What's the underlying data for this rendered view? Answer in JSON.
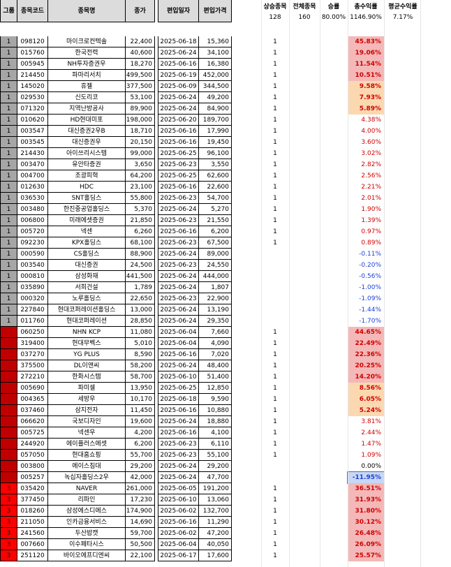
{
  "headers": {
    "group": "그룹",
    "code": "종목코드",
    "name": "종목명",
    "close": "종가",
    "date": "편입일자",
    "price": "편입가격"
  },
  "summary": {
    "labels": [
      "상승종목",
      "전체종목",
      "승률",
      "총수익률",
      "평균수익률"
    ],
    "values": [
      "128",
      "160",
      "80.00%",
      "1146.90%",
      "7.17%"
    ]
  },
  "colors": {
    "group1": "#a6a6a6",
    "group2": "#c00000",
    "group3": "#ff0000",
    "positive_text": "#d00000",
    "negative_text": "#1f3fd6",
    "heat_strong": "#f4b8b8",
    "heat_mid": "#fbd8b0",
    "heat_weak": "#fde9c4",
    "selected_neg": "#c7d7f5"
  },
  "rows": [
    {
      "g": "1",
      "code": "098120",
      "name": "마이크로컨텍솔",
      "close": "22,400",
      "date": "2025-06-18",
      "price": "15,360",
      "up": "1",
      "ret": "45.83%",
      "heat": "strong"
    },
    {
      "g": "1",
      "code": "015760",
      "name": "한국전력",
      "close": "40,600",
      "date": "2025-06-24",
      "price": "34,100",
      "up": "1",
      "ret": "19.06%",
      "heat": "strong"
    },
    {
      "g": "1",
      "code": "005945",
      "name": "NH투자증권우",
      "close": "18,270",
      "date": "2025-06-16",
      "price": "16,380",
      "up": "1",
      "ret": "11.54%",
      "heat": "strong"
    },
    {
      "g": "1",
      "code": "214450",
      "name": "파마리서치",
      "close": "499,500",
      "date": "2025-06-19",
      "price": "452,000",
      "up": "1",
      "ret": "10.51%",
      "heat": "strong"
    },
    {
      "g": "1",
      "code": "145020",
      "name": "휴젤",
      "close": "377,500",
      "date": "2025-06-09",
      "price": "344,500",
      "up": "1",
      "ret": "9.58%",
      "heat": "mid"
    },
    {
      "g": "1",
      "code": "029530",
      "name": "신도리코",
      "close": "53,100",
      "date": "2025-06-24",
      "price": "49,200",
      "up": "1",
      "ret": "7.93%",
      "heat": "mid"
    },
    {
      "g": "1",
      "code": "071320",
      "name": "지역난방공사",
      "close": "89,900",
      "date": "2025-06-24",
      "price": "84,900",
      "up": "1",
      "ret": "5.89%",
      "heat": "mid"
    },
    {
      "g": "1",
      "code": "010620",
      "name": "HD현대미포",
      "close": "198,000",
      "date": "2025-06-20",
      "price": "189,700",
      "up": "1",
      "ret": "4.38%",
      "heat": ""
    },
    {
      "g": "1",
      "code": "003547",
      "name": "대신증권2우B",
      "close": "18,710",
      "date": "2025-06-16",
      "price": "17,990",
      "up": "1",
      "ret": "4.00%",
      "heat": ""
    },
    {
      "g": "1",
      "code": "003545",
      "name": "대신증권우",
      "close": "20,150",
      "date": "2025-06-16",
      "price": "19,450",
      "up": "1",
      "ret": "3.60%",
      "heat": ""
    },
    {
      "g": "1",
      "code": "214430",
      "name": "아이쓰리시스템",
      "close": "99,000",
      "date": "2025-06-25",
      "price": "96,100",
      "up": "1",
      "ret": "3.02%",
      "heat": ""
    },
    {
      "g": "1",
      "code": "003470",
      "name": "유안타증권",
      "close": "3,650",
      "date": "2025-06-23",
      "price": "3,550",
      "up": "1",
      "ret": "2.82%",
      "heat": ""
    },
    {
      "g": "1",
      "code": "004700",
      "name": "조광피혁",
      "close": "64,200",
      "date": "2025-06-25",
      "price": "62,600",
      "up": "1",
      "ret": "2.56%",
      "heat": ""
    },
    {
      "g": "1",
      "code": "012630",
      "name": "HDC",
      "close": "23,100",
      "date": "2025-06-16",
      "price": "22,600",
      "up": "1",
      "ret": "2.21%",
      "heat": ""
    },
    {
      "g": "1",
      "code": "036530",
      "name": "SNT홀딩스",
      "close": "55,800",
      "date": "2025-06-23",
      "price": "54,700",
      "up": "1",
      "ret": "2.01%",
      "heat": ""
    },
    {
      "g": "1",
      "code": "003480",
      "name": "한진중공업홀딩스",
      "close": "5,370",
      "date": "2025-06-24",
      "price": "5,270",
      "up": "1",
      "ret": "1.90%",
      "heat": ""
    },
    {
      "g": "1",
      "code": "006800",
      "name": "미래에셋증권",
      "close": "21,850",
      "date": "2025-06-23",
      "price": "21,550",
      "up": "1",
      "ret": "1.39%",
      "heat": ""
    },
    {
      "g": "1",
      "code": "005720",
      "name": "넥센",
      "close": "6,260",
      "date": "2025-06-16",
      "price": "6,200",
      "up": "1",
      "ret": "0.97%",
      "heat": ""
    },
    {
      "g": "1",
      "code": "092230",
      "name": "KPX홀딩스",
      "close": "68,100",
      "date": "2025-06-23",
      "price": "67,500",
      "up": "1",
      "ret": "0.89%",
      "heat": ""
    },
    {
      "g": "1",
      "code": "000590",
      "name": "CS홀딩스",
      "close": "88,900",
      "date": "2025-06-24",
      "price": "89,000",
      "up": "",
      "ret": "-0.11%",
      "heat": ""
    },
    {
      "g": "1",
      "code": "003540",
      "name": "대신증권",
      "close": "24,500",
      "date": "2025-06-23",
      "price": "24,550",
      "up": "",
      "ret": "-0.20%",
      "heat": ""
    },
    {
      "g": "1",
      "code": "000810",
      "name": "삼성화재",
      "close": "441,500",
      "date": "2025-06-24",
      "price": "444,000",
      "up": "",
      "ret": "-0.56%",
      "heat": ""
    },
    {
      "g": "1",
      "code": "035890",
      "name": "서희건설",
      "close": "1,789",
      "date": "2025-06-24",
      "price": "1,807",
      "up": "",
      "ret": "-1.00%",
      "heat": ""
    },
    {
      "g": "1",
      "code": "000320",
      "name": "노루홀딩스",
      "close": "22,650",
      "date": "2025-06-23",
      "price": "22,900",
      "up": "",
      "ret": "-1.09%",
      "heat": ""
    },
    {
      "g": "1",
      "code": "227840",
      "name": "현대코퍼레이션홀딩스",
      "close": "13,000",
      "date": "2025-06-24",
      "price": "13,190",
      "up": "",
      "ret": "-1.44%",
      "heat": ""
    },
    {
      "g": "1",
      "code": "011760",
      "name": "현대코퍼레이션",
      "close": "28,850",
      "date": "2025-06-24",
      "price": "29,350",
      "up": "",
      "ret": "-1.70%",
      "heat": ""
    },
    {
      "g": "2",
      "code": "060250",
      "name": "NHN KCP",
      "close": "11,080",
      "date": "2025-06-04",
      "price": "7,660",
      "up": "1",
      "ret": "44.65%",
      "heat": "strong"
    },
    {
      "g": "2",
      "code": "319400",
      "name": "현대무벡스",
      "close": "5,010",
      "date": "2025-06-04",
      "price": "4,090",
      "up": "1",
      "ret": "22.49%",
      "heat": "strong"
    },
    {
      "g": "2",
      "code": "037270",
      "name": "YG PLUS",
      "close": "8,590",
      "date": "2025-06-16",
      "price": "7,020",
      "up": "1",
      "ret": "22.36%",
      "heat": "strong"
    },
    {
      "g": "2",
      "code": "375500",
      "name": "DL이앤씨",
      "close": "58,200",
      "date": "2025-06-24",
      "price": "48,400",
      "up": "1",
      "ret": "20.25%",
      "heat": "strong"
    },
    {
      "g": "2",
      "code": "272210",
      "name": "한화시스템",
      "close": "58,700",
      "date": "2025-06-10",
      "price": "51,400",
      "up": "1",
      "ret": "14.20%",
      "heat": "strong"
    },
    {
      "g": "2",
      "code": "005690",
      "name": "파미셀",
      "close": "13,950",
      "date": "2025-06-25",
      "price": "12,850",
      "up": "1",
      "ret": "8.56%",
      "heat": "mid"
    },
    {
      "g": "2",
      "code": "004365",
      "name": "세방우",
      "close": "10,170",
      "date": "2025-06-18",
      "price": "9,590",
      "up": "1",
      "ret": "6.05%",
      "heat": "mid"
    },
    {
      "g": "2",
      "code": "037460",
      "name": "삼지전자",
      "close": "11,450",
      "date": "2025-06-16",
      "price": "10,880",
      "up": "1",
      "ret": "5.24%",
      "heat": "mid"
    },
    {
      "g": "2",
      "code": "066620",
      "name": "국보디자인",
      "close": "19,600",
      "date": "2025-06-24",
      "price": "18,880",
      "up": "1",
      "ret": "3.81%",
      "heat": ""
    },
    {
      "g": "2",
      "code": "005725",
      "name": "넥센우",
      "close": "4,200",
      "date": "2025-06-16",
      "price": "4,100",
      "up": "1",
      "ret": "2.44%",
      "heat": ""
    },
    {
      "g": "2",
      "code": "244920",
      "name": "에이플러스에셋",
      "close": "6,200",
      "date": "2025-06-23",
      "price": "6,110",
      "up": "1",
      "ret": "1.47%",
      "heat": ""
    },
    {
      "g": "2",
      "code": "057050",
      "name": "현대홈쇼핑",
      "close": "55,700",
      "date": "2025-06-23",
      "price": "55,100",
      "up": "1",
      "ret": "1.09%",
      "heat": ""
    },
    {
      "g": "2",
      "code": "003800",
      "name": "에이스침대",
      "close": "29,200",
      "date": "2025-06-24",
      "price": "29,200",
      "up": "",
      "ret": "0.00%",
      "heat": "zero"
    },
    {
      "g": "2",
      "code": "005257",
      "name": "녹십자홀딩스2우",
      "close": "42,000",
      "date": "2025-06-24",
      "price": "47,700",
      "up": "",
      "ret": "-11.95%",
      "heat": "sel"
    },
    {
      "g": "3",
      "code": "035420",
      "name": "NAVER",
      "close": "261,000",
      "date": "2025-06-05",
      "price": "191,200",
      "up": "1",
      "ret": "36.51%",
      "heat": "strong"
    },
    {
      "g": "3",
      "code": "377450",
      "name": "리파인",
      "close": "17,230",
      "date": "2025-06-10",
      "price": "13,060",
      "up": "1",
      "ret": "31.93%",
      "heat": "strong"
    },
    {
      "g": "3",
      "code": "018260",
      "name": "삼성에스디에스",
      "close": "174,900",
      "date": "2025-06-02",
      "price": "132,700",
      "up": "1",
      "ret": "31.80%",
      "heat": "strong"
    },
    {
      "g": "3",
      "code": "211050",
      "name": "인카금융서비스",
      "close": "14,690",
      "date": "2025-06-16",
      "price": "11,290",
      "up": "1",
      "ret": "30.12%",
      "heat": "strong"
    },
    {
      "g": "3",
      "code": "241560",
      "name": "두산밥캣",
      "close": "59,700",
      "date": "2025-06-02",
      "price": "47,200",
      "up": "1",
      "ret": "26.48%",
      "heat": "strong"
    },
    {
      "g": "3",
      "code": "007660",
      "name": "이수페타시스",
      "close": "50,500",
      "date": "2025-06-04",
      "price": "40,050",
      "up": "1",
      "ret": "26.09%",
      "heat": "strong"
    },
    {
      "g": "3",
      "code": "251120",
      "name": "바이오에프디엔씨",
      "close": "22,100",
      "date": "2025-06-17",
      "price": "17,600",
      "up": "1",
      "ret": "25.57%",
      "heat": "strong"
    }
  ]
}
